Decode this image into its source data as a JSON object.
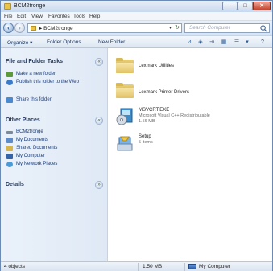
{
  "window": {
    "title": "BCM2tronge",
    "buttons": {
      "minimize": "–",
      "maximize": "□",
      "close": "✕"
    }
  },
  "menu": [
    "File",
    "Edit",
    "View",
    "Favorites",
    "Tools",
    "Help"
  ],
  "address": {
    "path": "▸ BCM2tronge",
    "search_placeholder": "Search Computer"
  },
  "command_bar": {
    "organize": "Organize ▾",
    "folder_options": "Folder Options",
    "new_folder": "New Folder"
  },
  "left_pane": {
    "file_folder_tasks": {
      "title": "File and Folder Tasks",
      "items": [
        {
          "label": "Make a new folder",
          "icon": "new-folder-icon"
        },
        {
          "label": "Publish this folder to the Web",
          "icon": "publish-web-icon"
        },
        {
          "label": "Share this folder",
          "icon": "share-folder-icon"
        }
      ]
    },
    "other_places": {
      "title": "Other Places",
      "items": [
        {
          "label": "BCM2tronge",
          "icon": "drive-icon"
        },
        {
          "label": "My Documents",
          "icon": "documents-icon"
        },
        {
          "label": "Shared Documents",
          "icon": "shared-documents-icon"
        },
        {
          "label": "My Computer",
          "icon": "computer-icon"
        },
        {
          "label": "My Network Places",
          "icon": "network-icon"
        }
      ]
    },
    "details": {
      "title": "Details"
    }
  },
  "files": [
    {
      "name": "Lexmark Utilities",
      "meta": [
        "",
        ""
      ],
      "icon": "folder-icon"
    },
    {
      "name": "Lexmark Printer Drivers",
      "meta": [
        "",
        ""
      ],
      "icon": "folder-icon"
    },
    {
      "name": "MSVCRT.EXE",
      "meta": [
        "Microsoft Visual C++ Redistributable",
        "1.56 MB"
      ],
      "icon": "installer-icon"
    },
    {
      "name": "Setup",
      "meta": [
        "5 items",
        ""
      ],
      "icon": "setup-icon"
    }
  ],
  "status": {
    "objects": "4 objects",
    "size": "1.50 MB",
    "location": "My Computer"
  },
  "colors": {
    "chrome": "#dfe9f5",
    "link": "#1b3c78",
    "close": "#c8432b"
  }
}
